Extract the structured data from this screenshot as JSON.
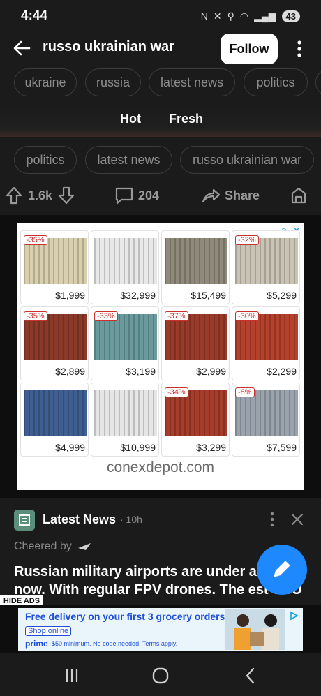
{
  "status": {
    "time": "4:44",
    "battery": "43"
  },
  "header": {
    "title": "russo ukrainian war",
    "follow_label": "Follow"
  },
  "top_chips": [
    "ukraine",
    "russia",
    "latest news",
    "politics"
  ],
  "tabs": [
    "Hot",
    "Fresh"
  ],
  "post_chips": [
    "politics",
    "latest news",
    "russo ukrainian war"
  ],
  "actions": {
    "upvotes": "1.6k",
    "comments": "204",
    "share_label": "Share"
  },
  "ad": {
    "domain": "conexdepot.com",
    "tiles": [
      {
        "price": "$1,999",
        "discount": "-35%",
        "color": "#d8cfae"
      },
      {
        "price": "$32,999",
        "discount": "",
        "color": "#e8e8e8"
      },
      {
        "price": "$15,499",
        "discount": "",
        "color": "#8f8a7a"
      },
      {
        "price": "$5,299",
        "discount": "-32%",
        "color": "#c9c3b4"
      },
      {
        "price": "$2,899",
        "discount": "-35%",
        "color": "#8b3a2a"
      },
      {
        "price": "$3,199",
        "discount": "-33%",
        "color": "#6a9a9c"
      },
      {
        "price": "$2,999",
        "discount": "-37%",
        "color": "#9a3a2a"
      },
      {
        "price": "$2,299",
        "discount": "-30%",
        "color": "#b5412c"
      },
      {
        "price": "$4,999",
        "discount": "",
        "color": "#3f5f93"
      },
      {
        "price": "$10,999",
        "discount": "",
        "color": "#e6e6e6"
      },
      {
        "price": "$3,299",
        "discount": "-34%",
        "color": "#a63c2a"
      },
      {
        "price": "$7,599",
        "discount": "-8%",
        "color": "#9aa3ad"
      }
    ]
  },
  "post": {
    "section": "Latest News",
    "time": "· 10h",
    "cheered_by": "Cheered by",
    "text": "Russian military airports are under a right now. With regular FPV drones. The est SBU operation that has the name"
  },
  "hide_ads_label": "HIDE ADS",
  "bottom_ad": {
    "headline": "Free delivery on your first 3 grocery orders",
    "button": "Shop online",
    "brand": "prime",
    "fine_print": "$50 minimum. No code needed. Terms apply."
  },
  "colors": {
    "accent": "#1e88ff",
    "background": "#1b1b1b",
    "chip_border": "#3c3c3c"
  }
}
